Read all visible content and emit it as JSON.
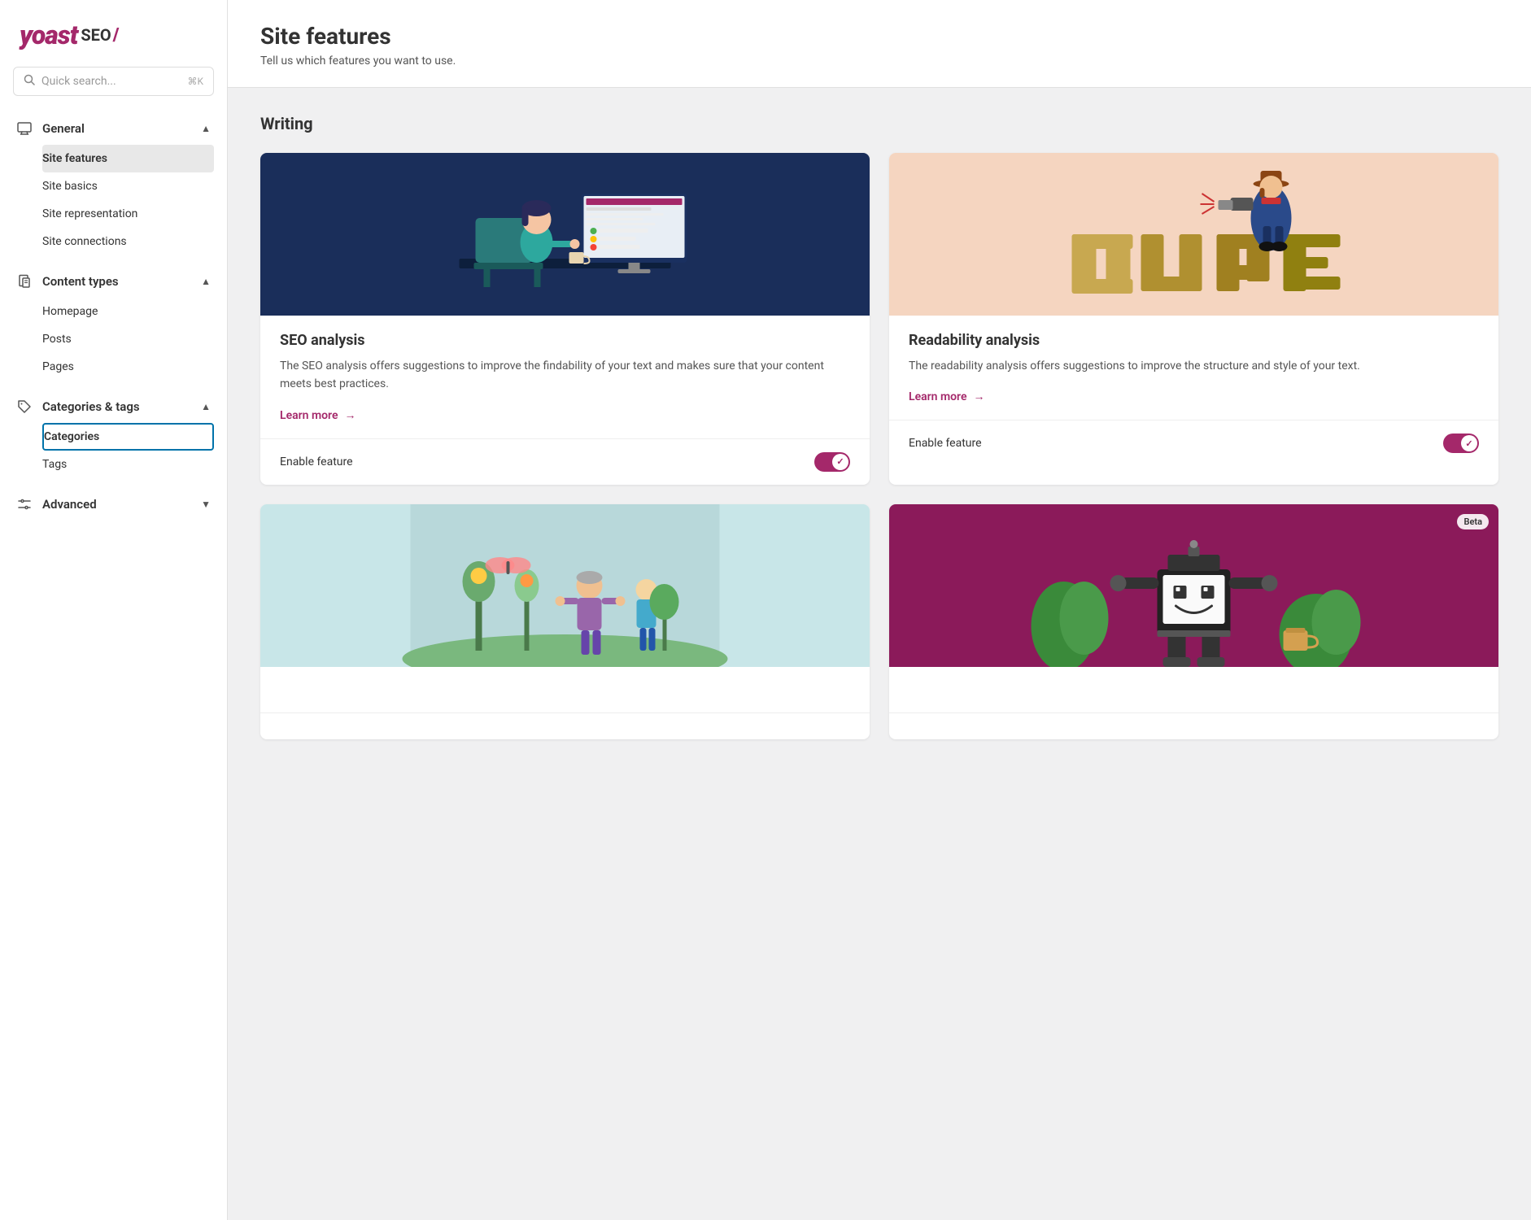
{
  "logo": {
    "yoast": "yoast",
    "seo": "SEO",
    "slash": "/"
  },
  "search": {
    "placeholder": "Quick search...",
    "shortcut": "⌘K"
  },
  "sidebar": {
    "sections": [
      {
        "id": "general",
        "icon": "monitor-icon",
        "title": "General",
        "expanded": true,
        "items": [
          {
            "id": "site-features",
            "label": "Site features",
            "active": true
          },
          {
            "id": "site-basics",
            "label": "Site basics",
            "active": false
          },
          {
            "id": "site-representation",
            "label": "Site representation",
            "active": false
          },
          {
            "id": "site-connections",
            "label": "Site connections",
            "active": false
          }
        ]
      },
      {
        "id": "content-types",
        "icon": "document-icon",
        "title": "Content types",
        "expanded": true,
        "items": [
          {
            "id": "homepage",
            "label": "Homepage",
            "active": false
          },
          {
            "id": "posts",
            "label": "Posts",
            "active": false
          },
          {
            "id": "pages",
            "label": "Pages",
            "active": false
          }
        ]
      },
      {
        "id": "categories-tags",
        "icon": "tag-icon",
        "title": "Categories & tags",
        "expanded": true,
        "items": [
          {
            "id": "categories",
            "label": "Categories",
            "active": false,
            "selected": true
          },
          {
            "id": "tags",
            "label": "Tags",
            "active": false
          }
        ]
      },
      {
        "id": "advanced",
        "icon": "settings-icon",
        "title": "Advanced",
        "expanded": false,
        "items": []
      }
    ]
  },
  "page": {
    "title": "Site features",
    "subtitle": "Tell us which features you want to use."
  },
  "writing_section": {
    "title": "Writing",
    "cards": [
      {
        "id": "seo-analysis",
        "title": "SEO analysis",
        "description": "The SEO analysis offers suggestions to improve the findability of your text and makes sure that your content meets best practices.",
        "learn_more": "Learn more",
        "enable_label": "Enable feature",
        "enabled": true,
        "beta": false,
        "image_type": "seo-desk"
      },
      {
        "id": "readability-analysis",
        "title": "Readability analysis",
        "description": "The readability analysis offers suggestions to improve the structure and style of your text.",
        "learn_more": "Learn more",
        "enable_label": "Enable feature",
        "enabled": true,
        "beta": false,
        "image_type": "readability"
      },
      {
        "id": "card-3",
        "title": "",
        "description": "",
        "learn_more": "",
        "enable_label": "",
        "enabled": false,
        "beta": false,
        "image_type": "garden"
      },
      {
        "id": "card-4",
        "title": "",
        "description": "",
        "learn_more": "",
        "enable_label": "",
        "enabled": false,
        "beta": true,
        "image_type": "robot"
      }
    ]
  }
}
